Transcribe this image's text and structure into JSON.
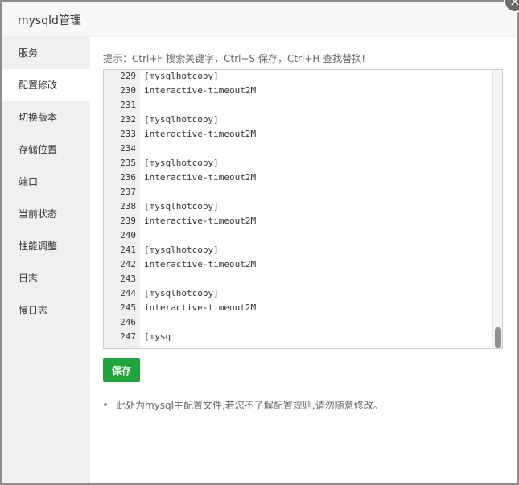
{
  "dialog": {
    "title": "mysqld管理",
    "close_icon": "close-icon"
  },
  "sidebar": {
    "items": [
      {
        "label": "服务",
        "active": false
      },
      {
        "label": "配置修改",
        "active": true
      },
      {
        "label": "切换版本",
        "active": false
      },
      {
        "label": "存储位置",
        "active": false
      },
      {
        "label": "端口",
        "active": false
      },
      {
        "label": "当前状态",
        "active": false
      },
      {
        "label": "性能调整",
        "active": false
      },
      {
        "label": "日志",
        "active": false
      },
      {
        "label": "慢日志",
        "active": false
      }
    ]
  },
  "content": {
    "hint": "提示：Ctrl+F 搜索关键字，Ctrl+S 保存，Ctrl+H 查找替换!",
    "editor": {
      "lines": [
        {
          "no": "229",
          "text": "[mysqlhotcopy]"
        },
        {
          "no": "230",
          "text": "interactive-timeout2M"
        },
        {
          "no": "231",
          "text": ""
        },
        {
          "no": "232",
          "text": "[mysqlhotcopy]"
        },
        {
          "no": "233",
          "text": "interactive-timeout2M"
        },
        {
          "no": "234",
          "text": ""
        },
        {
          "no": "235",
          "text": "[mysqlhotcopy]"
        },
        {
          "no": "236",
          "text": "interactive-timeout2M"
        },
        {
          "no": "237",
          "text": ""
        },
        {
          "no": "238",
          "text": "[mysqlhotcopy]"
        },
        {
          "no": "239",
          "text": "interactive-timeout2M"
        },
        {
          "no": "240",
          "text": ""
        },
        {
          "no": "241",
          "text": "[mysqlhotcopy]"
        },
        {
          "no": "242",
          "text": "interactive-timeout2M"
        },
        {
          "no": "243",
          "text": ""
        },
        {
          "no": "244",
          "text": "[mysqlhotcopy]"
        },
        {
          "no": "245",
          "text": "interactive-timeout2M"
        },
        {
          "no": "246",
          "text": ""
        },
        {
          "no": "247",
          "text": "[mysq"
        }
      ]
    },
    "save_label": "保存",
    "notes": [
      "此处为mysql主配置文件,若您不了解配置规则,请勿随意修改。"
    ]
  },
  "colors": {
    "accent": "#20a53a",
    "sidebar_bg": "#f0f0f0",
    "title_bg": "#f8f8f8"
  }
}
